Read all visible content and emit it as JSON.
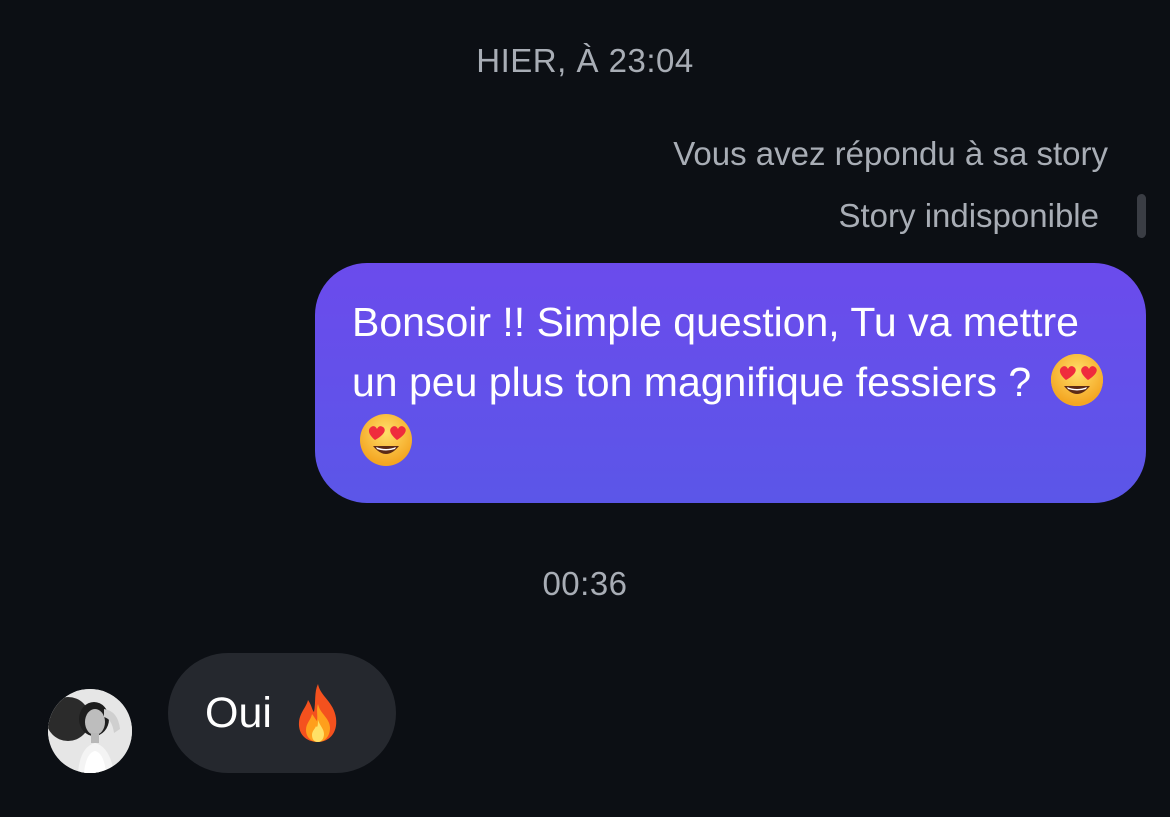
{
  "conversation": {
    "timestamp_1": "HIER, À 23:04",
    "story_reply_note": "Vous avez répondu à sa story",
    "story_status": "Story indisponible",
    "outgoing_message": {
      "text": "Bonsoir !! Simple question, Tu va mettre un peu plus ton magnifique fessiers ?",
      "emoji": [
        "heart-eyes-emoji",
        "heart-eyes-emoji"
      ]
    },
    "timestamp_2": "00:36",
    "incoming_message": {
      "text": "Oui",
      "emoji": [
        "fire-emoji"
      ]
    }
  },
  "colors": {
    "background": "#0c0f14",
    "outgoing_bubble_top": "#6b4bec",
    "outgoing_bubble_bottom": "#5b56e8",
    "incoming_bubble": "#25282e",
    "meta_text": "#a8adb5"
  },
  "icons": {
    "avatar": "avatar-photo",
    "story_indicator": "story-preview-placeholder"
  }
}
